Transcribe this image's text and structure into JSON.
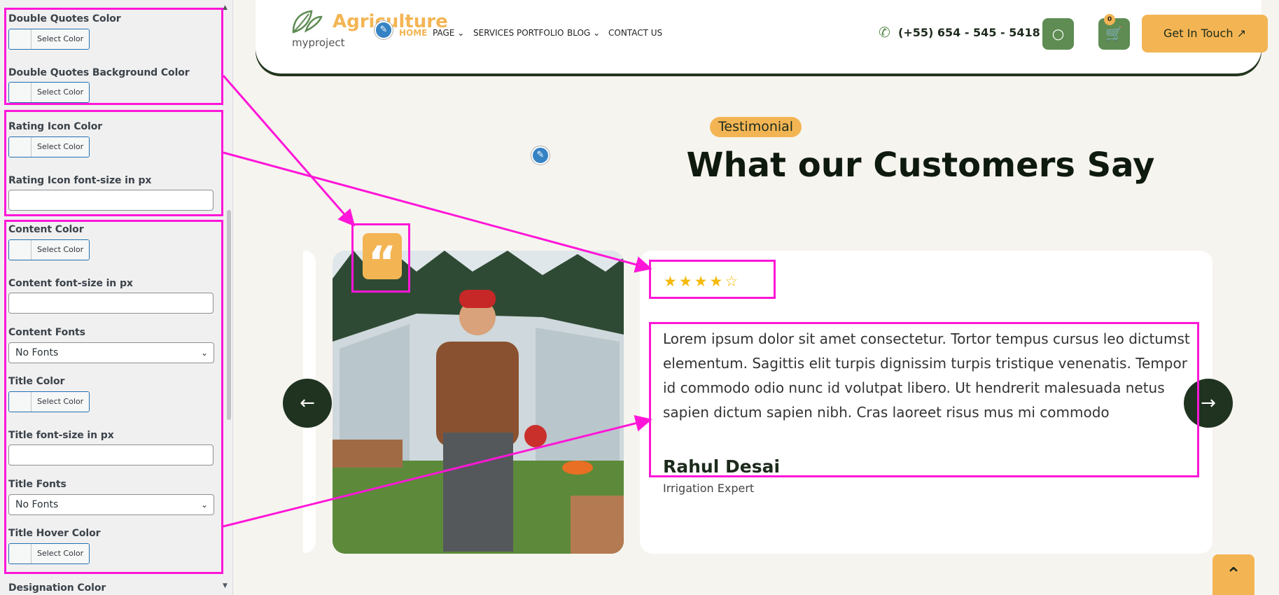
{
  "panel": {
    "fields": [
      {
        "label": "Double Quotes Color",
        "type": "color"
      },
      {
        "label": "Double Quotes Background Color",
        "type": "color"
      },
      {
        "label": "Rating Icon Color",
        "type": "color"
      },
      {
        "label": "Rating Icon font-size in px",
        "type": "text"
      },
      {
        "label": "Content Color",
        "type": "color"
      },
      {
        "label": "Content font-size in px",
        "type": "text"
      },
      {
        "label": "Content Fonts",
        "type": "select",
        "value": "No Fonts"
      },
      {
        "label": "Title Color",
        "type": "color"
      },
      {
        "label": "Title font-size in px",
        "type": "text"
      },
      {
        "label": "Title Fonts",
        "type": "select",
        "value": "No Fonts"
      },
      {
        "label": "Title Hover Color",
        "type": "color"
      },
      {
        "label": "Designation Color",
        "type": "color"
      }
    ],
    "select_color_label": "Select Color"
  },
  "site": {
    "logo": {
      "name": "Agriculture",
      "sub": "myproject"
    },
    "nav": [
      {
        "label": "HOME",
        "active": true
      },
      {
        "label": "PAGE",
        "has_dropdown": true
      },
      {
        "label": "SERVICES"
      },
      {
        "label": "PORTFOLIO"
      },
      {
        "label": "BLOG",
        "has_dropdown": true
      },
      {
        "label": "CONTACT US"
      }
    ],
    "phone": "(+55) 654 - 545 - 5418",
    "cart_count": "0",
    "cta": "Get In Touch",
    "section_tag": "Testimonial",
    "section_title": "What our Customers Say",
    "testimonial": {
      "rating": 4.5,
      "text": "Lorem ipsum dolor sit amet consectetur. Tortor tempus cursus leo dictumst elementum. Sagittis elit turpis dignissim turpis tristique venenatis. Tempor id commodo odio nunc id volutpat libero. Ut hendrerit malesuada netus sapien dictum sapien nibh. Cras laoreet risus mus mi commodo",
      "name": "Rahul Desai",
      "designation": "Irrigation Expert"
    },
    "colors": {
      "accent": "#f3b554",
      "green": "#5e8c53",
      "dark": "#1f3320",
      "highlight": "#ff16d8"
    }
  }
}
